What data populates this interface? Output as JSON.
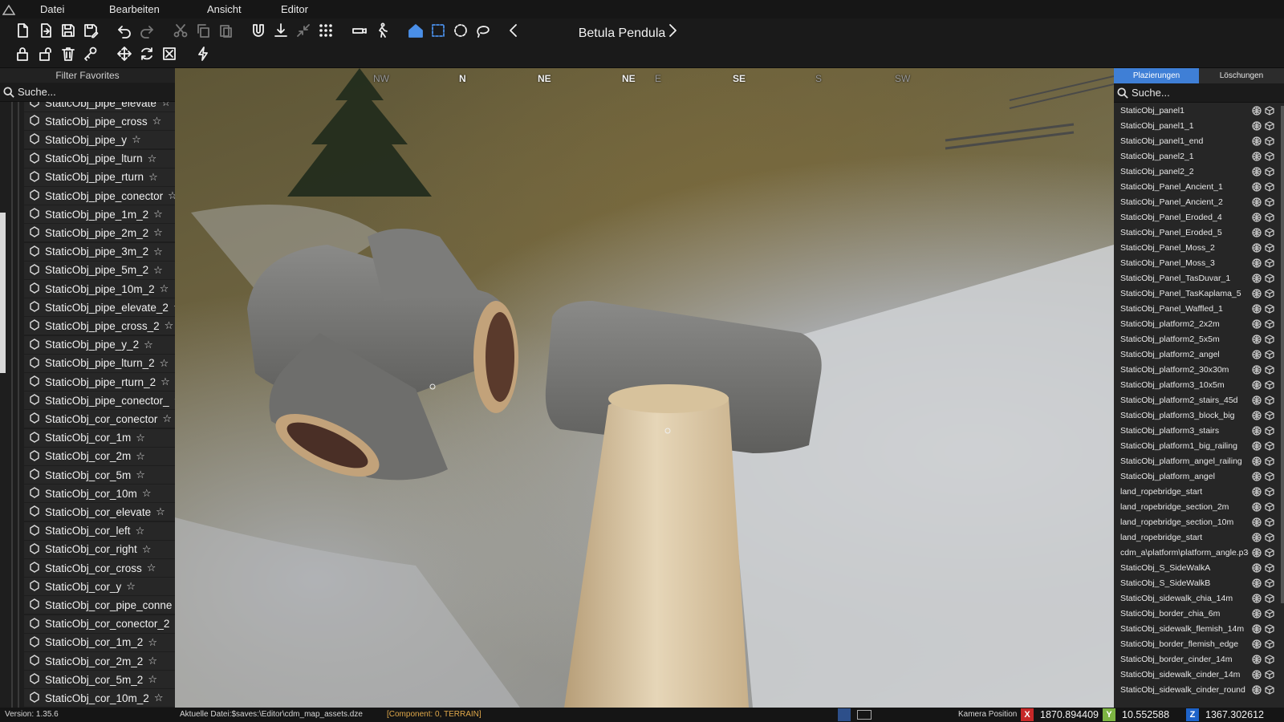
{
  "menubar": {
    "items": [
      "Datei",
      "Bearbeiten",
      "Ansicht",
      "Editor"
    ]
  },
  "toolbar": {
    "row1_icons": [
      "new-file-icon",
      "import-icon",
      "save-icon",
      "save-as-icon",
      "undo-icon",
      "redo-icon",
      "cut-icon",
      "copy-icon",
      "paste-icon",
      "magnet-icon",
      "drop-to-ground-icon",
      "collapse-icon",
      "grid-icon",
      "camera-speed-icon",
      "walk-icon",
      "home-icon",
      "box-select-icon",
      "circle-select-icon",
      "lasso-select-icon",
      "previous-icon",
      "next-icon"
    ],
    "row2_icons": [
      "lock-icon",
      "unlock-icon",
      "delete-icon",
      "key-icon",
      "move-icon",
      "rotate-icon",
      "scale-icon",
      "flash-icon"
    ],
    "asset_name": "Betula Pendula"
  },
  "left_panel": {
    "title": "Filter Favorites",
    "search_placeholder": "Suche...",
    "items": [
      "StaticObj_pipe_elevate",
      "StaticObj_pipe_cross",
      "StaticObj_pipe_y",
      "StaticObj_pipe_lturn",
      "StaticObj_pipe_rturn",
      "StaticObj_pipe_conector",
      "StaticObj_pipe_1m_2",
      "StaticObj_pipe_2m_2",
      "StaticObj_pipe_3m_2",
      "StaticObj_pipe_5m_2",
      "StaticObj_pipe_10m_2",
      "StaticObj_pipe_elevate_2",
      "StaticObj_pipe_cross_2",
      "StaticObj_pipe_y_2",
      "StaticObj_pipe_lturn_2",
      "StaticObj_pipe_rturn_2",
      "StaticObj_pipe_conector_",
      "StaticObj_cor_conector",
      "StaticObj_cor_1m",
      "StaticObj_cor_2m",
      "StaticObj_cor_5m",
      "StaticObj_cor_10m",
      "StaticObj_cor_elevate",
      "StaticObj_cor_left",
      "StaticObj_cor_right",
      "StaticObj_cor_cross",
      "StaticObj_cor_y",
      "StaticObj_cor_pipe_conne",
      "StaticObj_cor_conector_2",
      "StaticObj_cor_1m_2",
      "StaticObj_cor_2m_2",
      "StaticObj_cor_5m_2",
      "StaticObj_cor_10m_2"
    ]
  },
  "viewport": {
    "compass": [
      "NW",
      "N",
      "NE",
      "NE",
      "E",
      "SE",
      "S",
      "SW"
    ]
  },
  "right_panel": {
    "tabs": [
      "Plazierungen",
      "Löschungen"
    ],
    "search_placeholder": "Suche...",
    "items": [
      "StaticObj_panel1",
      "StaticObj_panel1_1",
      "StaticObj_panel1_end",
      "StaticObj_panel2_1",
      "StaticObj_panel2_2",
      "StaticObj_Panel_Ancient_1",
      "StaticObj_Panel_Ancient_2",
      "StaticObj_Panel_Eroded_4",
      "StaticObj_Panel_Eroded_5",
      "StaticObj_Panel_Moss_2",
      "StaticObj_Panel_Moss_3",
      "StaticObj_Panel_TasDuvar_1",
      "StaticObj_Panel_TasKaplama_5",
      "StaticObj_Panel_Waffled_1",
      "StaticObj_platform2_2x2m",
      "StaticObj_platform2_5x5m",
      "StaticObj_platform2_angel",
      "StaticObj_platform2_30x30m",
      "StaticObj_platform3_10x5m",
      "StaticObj_platform2_stairs_45d",
      "StaticObj_platform3_block_big",
      "StaticObj_platform3_stairs",
      "StaticObj_platform1_big_railing",
      "StaticObj_platform_angel_railing",
      "StaticObj_platform_angel",
      "land_ropebridge_start",
      "land_ropebridge_section_2m",
      "land_ropebridge_section_10m",
      "land_ropebridge_start",
      "cdm_a\\platform\\platform_angle.p3d",
      "StaticObj_S_SideWalkA",
      "StaticObj_S_SideWalkB",
      "StaticObj_sidewalk_chia_14m",
      "StaticObj_border_chia_6m",
      "StaticObj_sidewalk_flemish_14m",
      "StaticObj_border_flemish_edge",
      "StaticObj_border_cinder_14m",
      "StaticObj_sidewalk_cinder_14m",
      "StaticObj_sidewalk_cinder_round"
    ]
  },
  "statusbar": {
    "version": "Version:  1.35.6",
    "current_file": "Aktuelle Datei:$saves:\\Editor\\cdm_map_assets.dze",
    "component": "[Component: 0, TERRAIN]",
    "camera_label": "Kamera Position",
    "x_label": "X",
    "x_value": "1870.894409",
    "y_label": "Y",
    "y_value": "10.552588",
    "z_label": "Z",
    "z_value": "1367.302612"
  },
  "colors": {
    "accent": "#3f7fd6",
    "x_axis": "#c62828",
    "y_axis": "#7cb342",
    "z_axis": "#1e63c9"
  }
}
